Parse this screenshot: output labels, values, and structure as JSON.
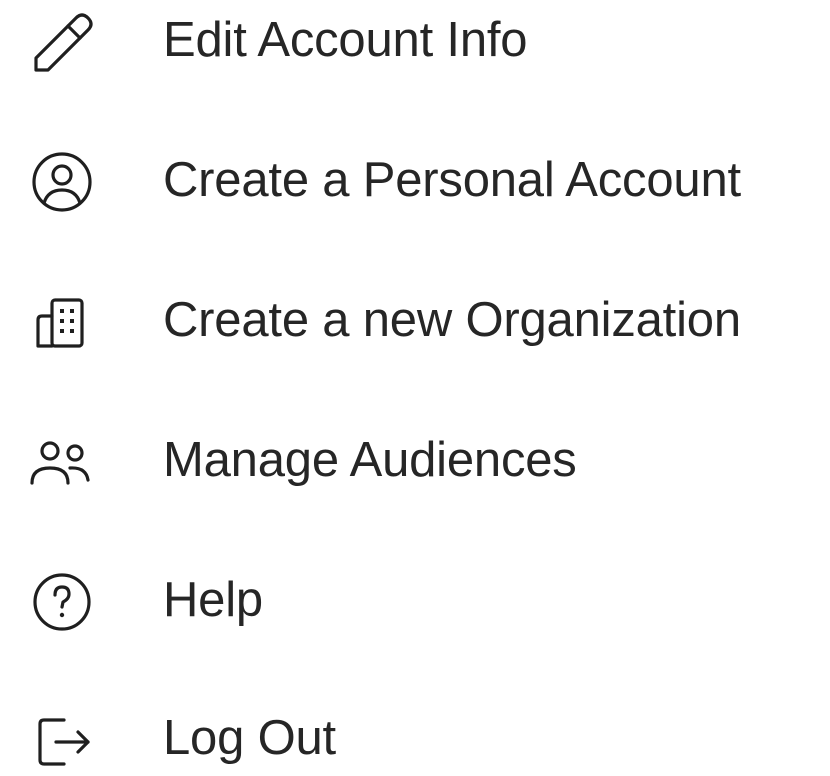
{
  "menu": {
    "items": [
      {
        "label": "Edit Account Info",
        "icon": "pencil-icon"
      },
      {
        "label": "Create a Personal Account",
        "icon": "user-circle-icon"
      },
      {
        "label": "Create a new Organization",
        "icon": "building-icon"
      },
      {
        "label": "Manage Audiences",
        "icon": "users-icon"
      },
      {
        "label": "Help",
        "icon": "help-circle-icon"
      },
      {
        "label": "Log Out",
        "icon": "logout-icon"
      }
    ]
  },
  "colors": {
    "text": "#262626",
    "icon": "#1f1f1f",
    "background": "#ffffff"
  }
}
